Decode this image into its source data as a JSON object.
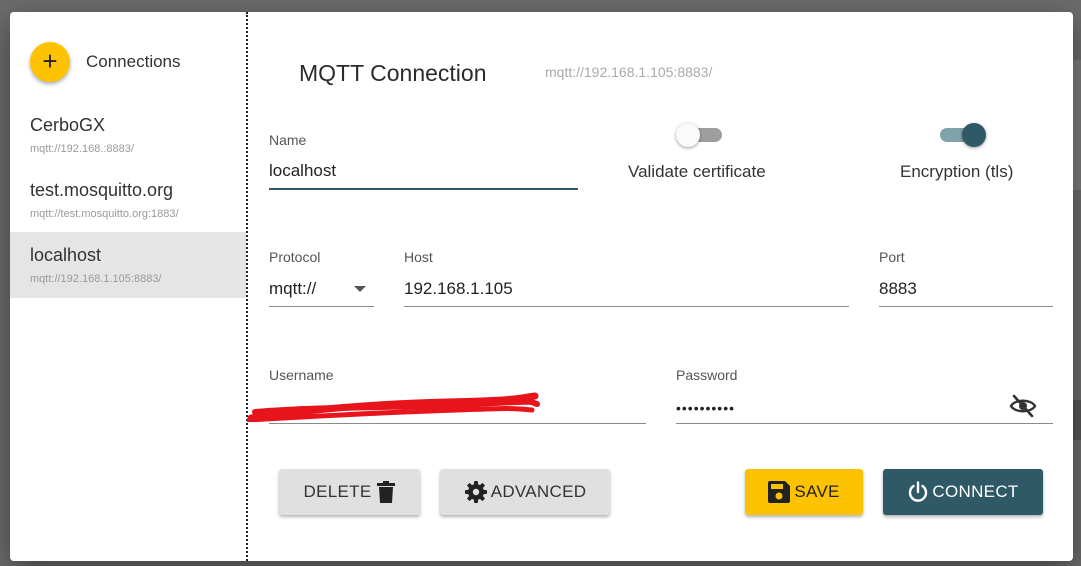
{
  "sidebar": {
    "add_icon": "plus-icon",
    "title": "Connections",
    "items": [
      {
        "name": "CerboGX",
        "url": "mqtt://192.168.:8883/"
      },
      {
        "name": "test.mosquitto.org",
        "url": "mqtt://test.mosquitto.org:1883/"
      },
      {
        "name": "localhost",
        "url": "mqtt://192.168.1.105:8883/"
      }
    ]
  },
  "main": {
    "title": "MQTT Connection",
    "subtitle": "mqtt://192.168.1.105:8883/",
    "name_label": "Name",
    "name_value": "localhost",
    "validate_label": "Validate certificate",
    "validate_on": false,
    "encryption_label": "Encryption (tls)",
    "encryption_on": true,
    "protocol_label": "Protocol",
    "protocol_value": "mqtt://",
    "host_label": "Host",
    "host_value": "192.168.1.105",
    "port_label": "Port",
    "port_value": "8883",
    "username_label": "Username",
    "password_label": "Password",
    "password_value": "••••••••••",
    "buttons": {
      "delete": "DELETE",
      "advanced": "ADVANCED",
      "save": "SAVE",
      "connect": "CONNECT"
    }
  },
  "colors": {
    "accent_yellow": "#fdc300",
    "primary_teal": "#2f5966"
  },
  "icons": {
    "delete": "trash-icon",
    "advanced": "gear-icon",
    "save": "floppy-disk-icon",
    "connect": "power-icon",
    "password_toggle": "eye-off-icon",
    "protocol_dropdown": "caret-down-icon"
  }
}
